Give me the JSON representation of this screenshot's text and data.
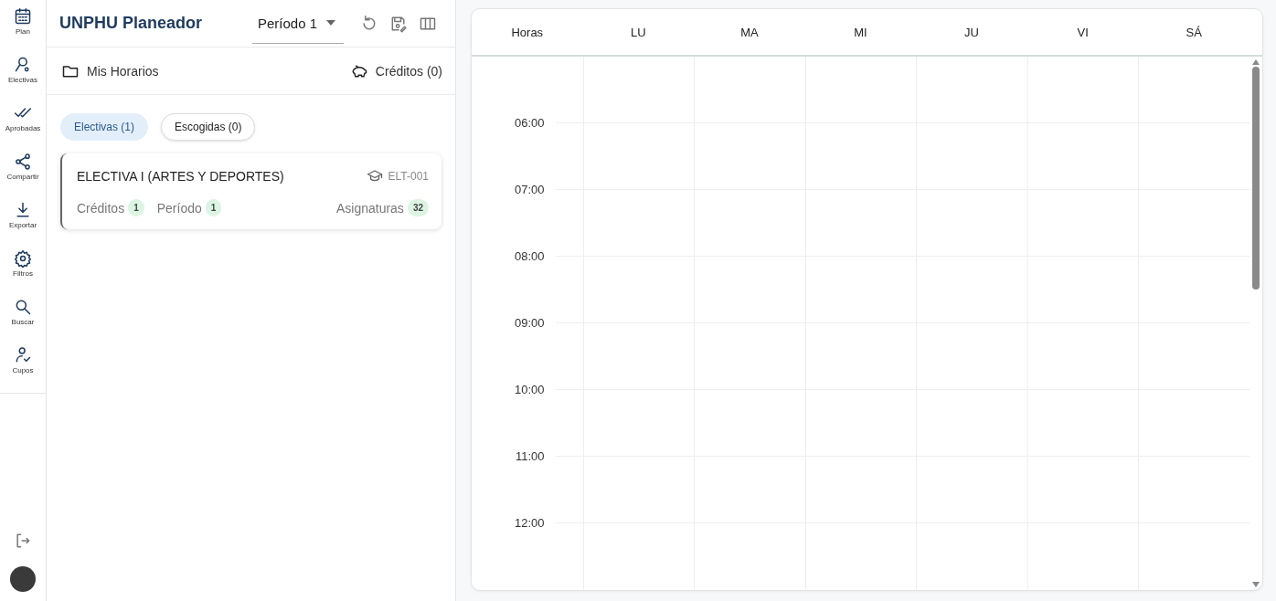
{
  "sidebar": {
    "items": [
      {
        "kind": "calendar",
        "label": "Plan"
      },
      {
        "kind": "person-search",
        "label": "Electivas"
      },
      {
        "kind": "double-check",
        "label": "Aprobadas"
      },
      {
        "kind": "share",
        "label": "Compartir"
      },
      {
        "kind": "download",
        "label": "Exportar"
      },
      {
        "kind": "gear",
        "label": "Filtros"
      },
      {
        "kind": "search",
        "label": "Buscar"
      },
      {
        "kind": "person-check",
        "label": "Cupos"
      }
    ]
  },
  "header": {
    "title": "UNPHU Planeador",
    "period_select": {
      "value": "Período 1"
    }
  },
  "schedules": {
    "label": "Mis Horarios",
    "credits": "Créditos (0)"
  },
  "tabs": [
    {
      "label": "Electivas (1)",
      "selected": true
    },
    {
      "label": "Escogidas (0)",
      "selected": false
    }
  ],
  "courses": [
    {
      "title": "ELECTIVA I (ARTES Y DEPORTES)",
      "code": "ELT-001",
      "stats": [
        {
          "label": "Créditos",
          "value": "1"
        },
        {
          "label": "Período",
          "value": "1"
        }
      ],
      "subjects": {
        "label": "Asignaturas",
        "value": "32"
      }
    }
  ],
  "calendar": {
    "columns": [
      "Horas",
      "LU",
      "MA",
      "MI",
      "JU",
      "VI",
      "SÁ"
    ],
    "hours": [
      "06:00",
      "07:00",
      "08:00",
      "09:00",
      "10:00",
      "11:00",
      "12:00"
    ]
  }
}
